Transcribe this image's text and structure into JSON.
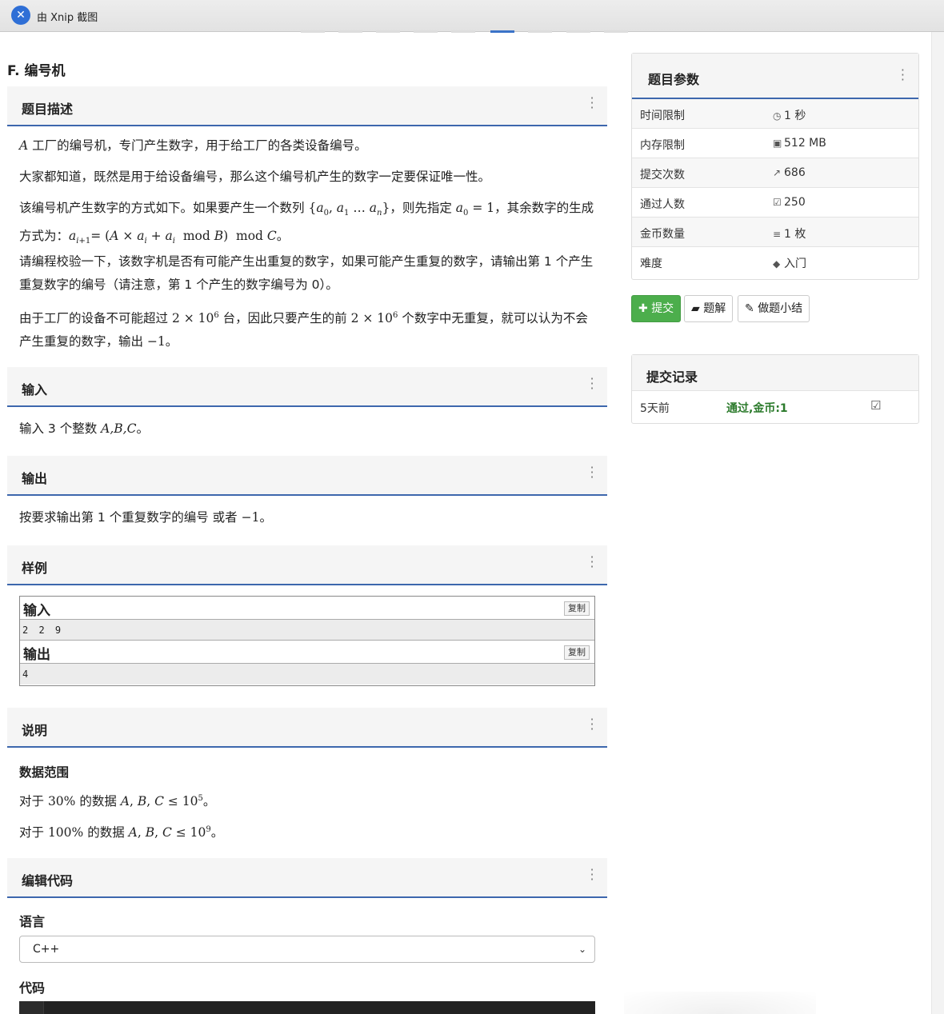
{
  "xnip": {
    "logo_glyph": "✕",
    "title": "由 Xnip 截图"
  },
  "problem": {
    "title": "F. 编号机"
  },
  "sections": {
    "description": "题目描述",
    "input": "输入",
    "output": "输出",
    "sample": "样例",
    "explanation": "说明",
    "editor": "编辑代码"
  },
  "description": {
    "p1_var": "A",
    "p1_text": " 工厂的编号机，专门产生数字，用于给工厂的各类设备编号。",
    "p2": "大家都知道，既然是用于给设备编号，那么这个编号机产生的数字一定要保证唯一性。",
    "p3_a": "该编号机产生数字的方式如下。如果要产生一个数列 ",
    "p3_b": "，则先指定 ",
    "p3_c": "，其余数字的生成方式为：",
    "p4": "请编程校验一下，该数字机是否有可能产生出重复的数字，如果可能产生重复的数字，请输出第 1 个产生重复数字的编号（请注意，第 1 个产生的数字编号为 0）。",
    "p5_a": "由于工厂的设备不可能超过 ",
    "p5_b": " 台，因此只要产生的前 ",
    "p5_c": " 个数字中无重复，就可以认为不会产生重复的数字，输出 ",
    "p5_d": "。"
  },
  "input_text": {
    "a": "输入 3 个整数 ",
    "vars": "A,B,C",
    "b": "。"
  },
  "output_text": {
    "a": "按要求输出第 1 个重复数字的编号 或者 ",
    "val": "−1",
    "b": "。"
  },
  "sample": {
    "input_label": "输入",
    "input_value": "2 2 9",
    "output_label": "输出",
    "output_value": "4",
    "copy_label": "复制"
  },
  "explanation": {
    "heading": "数据范围",
    "l1_a": "对于 ",
    "l1_pct": "30%",
    "l1_b": " 的数据 ",
    "l1_exp": "5",
    "l2_a": "对于 ",
    "l2_pct": "100%",
    "l2_b": " 的数据 ",
    "l2_exp": "9"
  },
  "editor": {
    "language_label": "语言",
    "language_value": "C++",
    "code_label": "代码"
  },
  "params": {
    "title": "题目参数",
    "rows": [
      {
        "key": "时间限制",
        "icon": "clock-icon",
        "value": "1 秒"
      },
      {
        "key": "内存限制",
        "icon": "save-icon",
        "value": "512 MB"
      },
      {
        "key": "提交次数",
        "icon": "share-icon",
        "value": "686"
      },
      {
        "key": "通过人数",
        "icon": "check-square-icon",
        "value": "250"
      },
      {
        "key": "金币数量",
        "icon": "database-icon",
        "value": "1 枚"
      },
      {
        "key": "难度",
        "icon": "tag-icon",
        "value": "入门"
      }
    ]
  },
  "actions": {
    "submit": "提交",
    "solution": "题解",
    "summary": "做题小结"
  },
  "records": {
    "title": "提交记录",
    "items": [
      {
        "time": "5天前",
        "status": "通过,金币:1"
      }
    ]
  },
  "colors": {
    "accent": "#3d67ad",
    "success": "#4cae4c",
    "pass_text": "#2b7a2b"
  }
}
